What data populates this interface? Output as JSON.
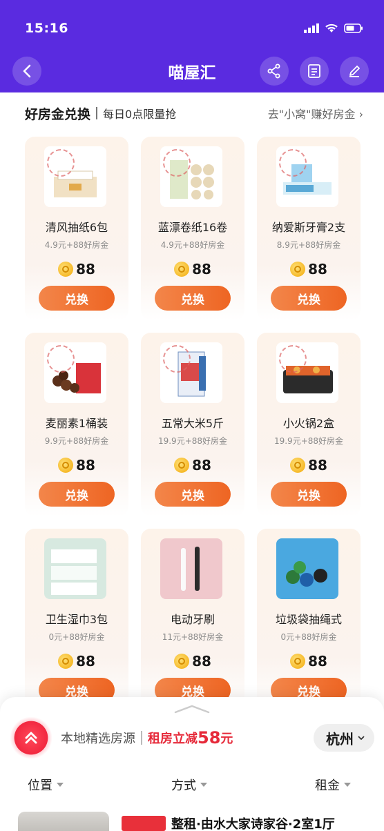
{
  "status_bar": {
    "time": "15:16"
  },
  "header": {
    "title": "喵屋汇"
  },
  "section": {
    "title": "好房金兑换",
    "subtitle": "每日0点限量抢",
    "link": "去\"小窝\"赚好房金 ›"
  },
  "products": [
    {
      "name": "清风抽纸6包",
      "price": "4.9元+88好房金",
      "coins": "88",
      "button": "兑换",
      "icon": "tissue-box-icon"
    },
    {
      "name": "蓝漂卷纸16卷",
      "price": "4.9元+88好房金",
      "coins": "88",
      "button": "兑换",
      "icon": "toilet-paper-icon"
    },
    {
      "name": "纳爱斯牙膏2支",
      "price": "8.9元+88好房金",
      "coins": "88",
      "button": "兑换",
      "icon": "toothpaste-icon"
    },
    {
      "name": "麦丽素1桶装",
      "price": "9.9元+88好房金",
      "coins": "88",
      "button": "兑换",
      "icon": "chocolate-bucket-icon"
    },
    {
      "name": "五常大米5斤",
      "price": "19.9元+88好房金",
      "coins": "88",
      "button": "兑换",
      "icon": "rice-bag-icon"
    },
    {
      "name": "小火锅2盒",
      "price": "19.9元+88好房金",
      "coins": "88",
      "button": "兑换",
      "icon": "hotpot-icon"
    },
    {
      "name": "卫生湿巾3包",
      "price": "0元+88好房金",
      "coins": "88",
      "button": "兑换",
      "icon": "wet-wipes-icon"
    },
    {
      "name": "电动牙刷",
      "price": "11元+88好房金",
      "coins": "88",
      "button": "兑换",
      "icon": "electric-toothbrush-icon"
    },
    {
      "name": "垃圾袋抽绳式",
      "price": "0元+88好房金",
      "coins": "88",
      "button": "兑换",
      "icon": "garbage-bags-icon"
    }
  ],
  "bottom_sheet": {
    "promo_label": "本地精选房源",
    "promo_offer": "租房立减",
    "promo_amount": "58",
    "promo_unit": "元",
    "city": "杭州",
    "filters": [
      "位置",
      "方式",
      "租金"
    ],
    "listing": {
      "tag": "",
      "title": "整租·由水大家诗家谷·2室1厅"
    }
  },
  "colors": {
    "header_bg": "#5a2be0",
    "button_orange": "#ee6523",
    "promo_red": "#e62a3a"
  }
}
